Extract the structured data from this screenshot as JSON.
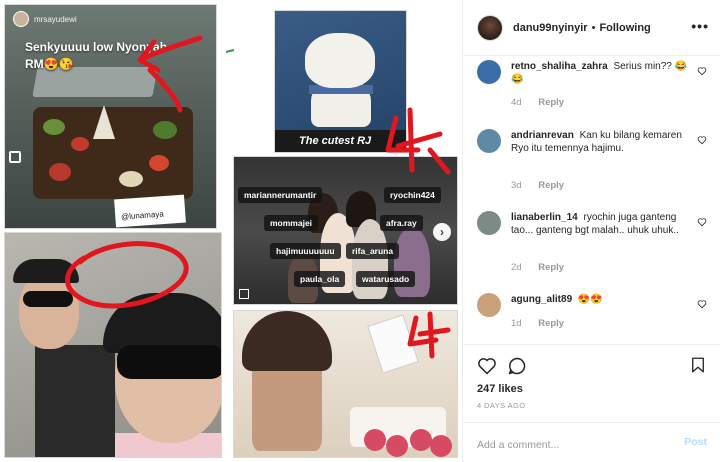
{
  "collage": {
    "story1": {
      "user": "mrsayudewi",
      "caption": "Senkyuuuu low Nyonyah RM😍😘",
      "card_tag": "@lunamaya"
    },
    "plush": {
      "caption": "The cutest RJ"
    },
    "group_story": {
      "tags": [
        "mariannerumantir",
        "ryochin424",
        "mommajei",
        "afra.ray",
        "hajimuuuuuuu",
        "rifa_aruna",
        "paula_ola",
        "watarusado"
      ]
    },
    "annotation_color": "#e0171f"
  },
  "post": {
    "header": {
      "username": "danu99nyinyir",
      "separator": "•",
      "follow_label": "Following",
      "more_glyph": "•••"
    },
    "comments": [
      {
        "username": "retno_shaliha_zahra",
        "text": "Serius min?? 😂😂",
        "age": "4d",
        "reply": "Reply",
        "avatar_color": "#3b6ea8"
      },
      {
        "username": "andrianrevan",
        "text": "Kan ku bilang kemaren Ryo itu temennya hajimu.",
        "age": "3d",
        "reply": "Reply",
        "avatar_color": "#5f8aa6"
      },
      {
        "username": "lianaberlin_14",
        "text": "ryochin juga ganteng tao... ganteng bgt malah.. uhuk uhuk..",
        "age": "2d",
        "reply": "Reply",
        "avatar_color": "#7d8a86"
      },
      {
        "username": "agung_alit89",
        "text": "😍😍",
        "age": "1d",
        "reply": "Reply",
        "avatar_color": "#c9a27c"
      }
    ],
    "likes": "247 likes",
    "time": "4 DAYS AGO",
    "add_comment_placeholder": "Add a comment...",
    "post_button": "Post"
  }
}
